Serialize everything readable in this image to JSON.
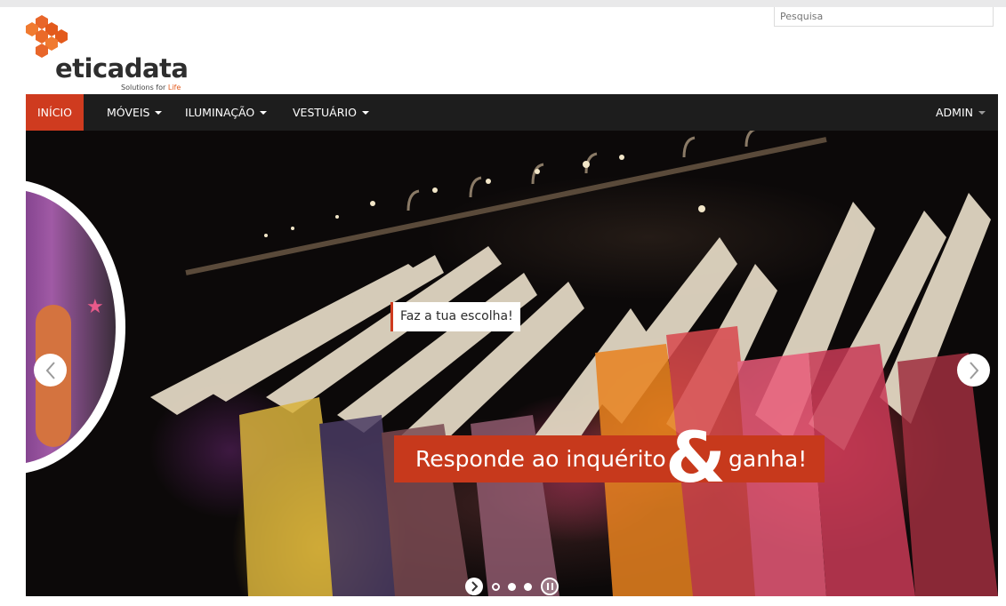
{
  "header": {
    "search_placeholder": "Pesquisa",
    "logo": {
      "wordmark": "eticadata",
      "tagline_prefix": "Solutions for ",
      "tagline_highlight": "Life"
    }
  },
  "nav": {
    "items": [
      {
        "label": "INÍCIO",
        "active": true,
        "dropdown": false
      },
      {
        "label": "MÓVEIS",
        "active": false,
        "dropdown": true
      },
      {
        "label": "ILUMINAÇÃO",
        "active": false,
        "dropdown": true
      },
      {
        "label": "VESTUÁRIO",
        "active": false,
        "dropdown": true
      }
    ],
    "admin_label": "ADMIN"
  },
  "slider": {
    "tagline": "Faz a tua escolha!",
    "banner_left": "Responde ao inquérito",
    "banner_amp": "&",
    "banner_right": "ganha!",
    "prev_icon": "chevron-left-icon",
    "next_icon": "chevron-right-icon",
    "slide_count": 4,
    "current_slide": 1
  },
  "colors": {
    "accent": "#cf3b1f",
    "banner": "#c7391c",
    "navbar": "#1d1d1d",
    "logo_orange": "#e8662a"
  }
}
